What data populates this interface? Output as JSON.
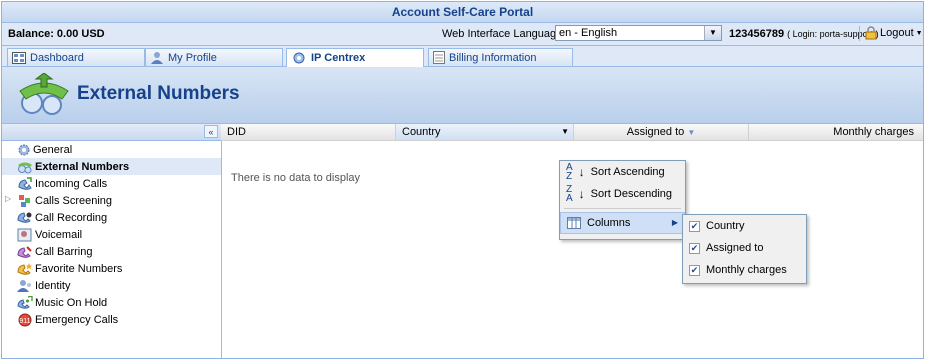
{
  "portal_title": "Account Self-Care Portal",
  "infobar": {
    "balance": "Balance: 0.00 USD",
    "lang_label": "Web Interface Language:",
    "lang_value": "en - English",
    "account_id": "123456789",
    "login_text": "( Login: porta-support )",
    "logout": "Logout"
  },
  "tabs": [
    "Dashboard",
    "My Profile",
    "IP Centrex",
    "Billing Information"
  ],
  "page_title": "External Numbers",
  "sidebar": {
    "items": [
      {
        "label": "General",
        "icon": "gear-icon"
      },
      {
        "label": "External Numbers",
        "icon": "external-numbers-icon"
      },
      {
        "label": "Incoming Calls",
        "icon": "incoming-calls-icon"
      },
      {
        "label": "Calls Screening",
        "icon": "calls-screening-icon"
      },
      {
        "label": "Call Recording",
        "icon": "call-recording-icon"
      },
      {
        "label": "Voicemail",
        "icon": "voicemail-icon"
      },
      {
        "label": "Call Barring",
        "icon": "call-barring-icon"
      },
      {
        "label": "Favorite Numbers",
        "icon": "favorite-numbers-icon"
      },
      {
        "label": "Identity",
        "icon": "identity-icon"
      },
      {
        "label": "Music On Hold",
        "icon": "music-icon"
      },
      {
        "label": "Emergency Calls",
        "icon": "emergency-icon"
      }
    ]
  },
  "grid": {
    "columns": [
      "DID",
      "Country",
      "Assigned to",
      "Monthly charges"
    ],
    "empty_text": "There is no data to display"
  },
  "column_menu": {
    "sort_asc": "Sort Ascending",
    "sort_desc": "Sort Descending",
    "columns": "Columns"
  },
  "columns_submenu": [
    {
      "label": "Country",
      "checked": true
    },
    {
      "label": "Assigned to",
      "checked": true
    },
    {
      "label": "Monthly charges",
      "checked": true
    }
  ],
  "colors": {
    "accent": "#15428b",
    "panel": "#dfe8f6",
    "border": "#99bbe8"
  }
}
